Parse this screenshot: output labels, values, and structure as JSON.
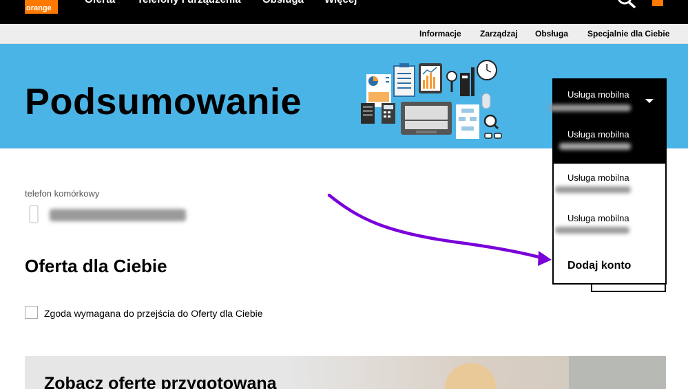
{
  "brand": {
    "logo_text": "orange",
    "accent": "#ff7900"
  },
  "topnav": {
    "items": [
      "Oferta",
      "Telefony i urządzenia",
      "Obsługa",
      "Więcej"
    ]
  },
  "subnav": {
    "items": [
      "Informacje",
      "Zarządzaj",
      "Obsługa",
      "Specjalnie dla Ciebie"
    ]
  },
  "banner": {
    "title": "Podsumowanie",
    "background": "#4bb4e6"
  },
  "account": {
    "label": "telefon komórkowy"
  },
  "offer": {
    "heading": "Oferta dla Ciebie",
    "consent_label": "Zgoda wymagana do przejścia do Oferty dla Ciebie",
    "promo_title": "Zobacz ofertę przygotowaną"
  },
  "dropdown": {
    "current": "Usługa mobilna",
    "options": [
      "Usługa mobilna",
      "Usługa mobilna",
      "Usługa mobilna"
    ],
    "add_account": "Dodaj konto"
  },
  "annotation": {
    "arrow_color": "#7a00d9"
  }
}
